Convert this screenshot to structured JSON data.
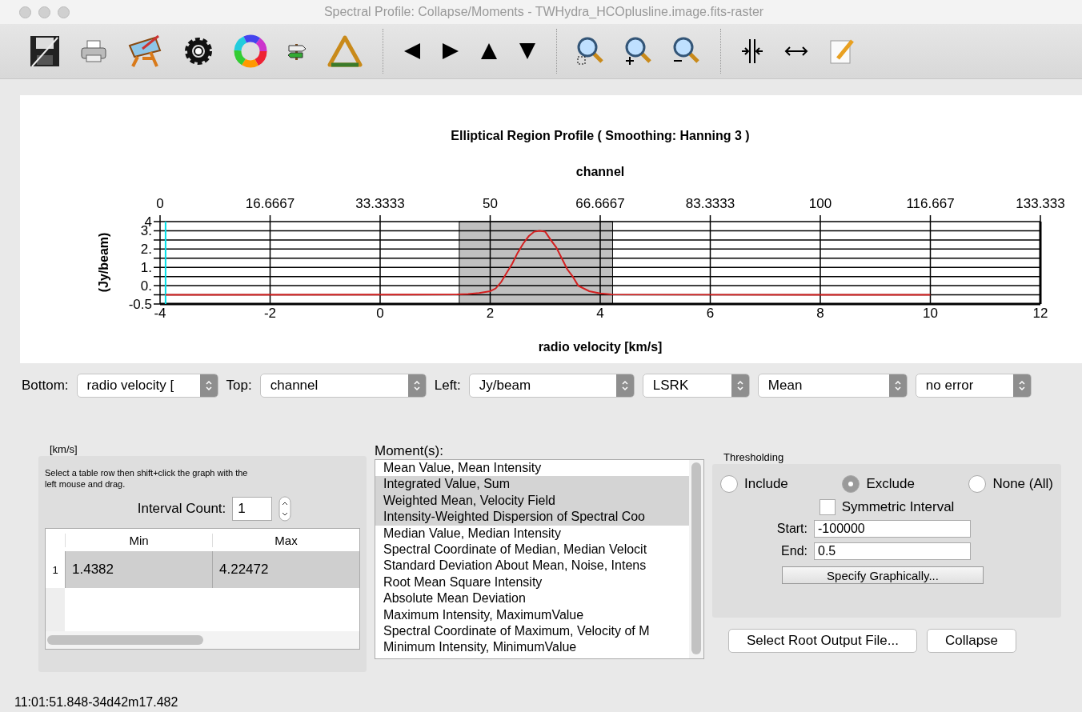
{
  "window": {
    "title": "Spectral Profile: Collapse/Moments - TWHydra_HCOplusline.image.fits-raster"
  },
  "plot": {
    "top_axis": {
      "label": "channel",
      "ticks": [
        "0",
        "16.6667",
        "33.3333",
        "50",
        "66.6667",
        "83.3333",
        "100",
        "116.667",
        "133.333"
      ]
    },
    "chart_data": {
      "type": "line",
      "title": "Elliptical Region Profile ( Smoothing: Hanning 3 )",
      "xlabel": "radio velocity [km/s]",
      "ylabel": "(Jy/beam)",
      "xlim": [
        -4,
        12
      ],
      "ylim": [
        -0.5,
        4
      ],
      "xticks": [
        -4,
        -2,
        0,
        2,
        4,
        6,
        8,
        10,
        12
      ],
      "yticks": [
        {
          "value": 4,
          "label": "4"
        },
        {
          "value": 3.5,
          "label": "3."
        },
        {
          "value": 2.5,
          "label": "2."
        },
        {
          "value": 1.5,
          "label": "1."
        },
        {
          "value": 0.5,
          "label": "0."
        },
        {
          "value": -0.5,
          "label": "-0.5"
        }
      ],
      "x": [
        -3.9,
        1.4,
        1.6,
        1.8,
        2.0,
        2.1,
        2.2,
        2.3,
        2.4,
        2.5,
        2.6,
        2.7,
        2.8,
        2.9,
        3.0,
        3.1,
        3.2,
        3.3,
        3.4,
        3.5,
        3.6,
        3.8,
        4.0,
        4.2,
        10
      ],
      "series": [
        {
          "color": "#d42020",
          "values": [
            0,
            0.02,
            0.05,
            0.1,
            0.2,
            0.35,
            0.7,
            1.2,
            1.7,
            2.3,
            2.8,
            3.2,
            3.45,
            3.5,
            3.45,
            3.0,
            2.6,
            2.0,
            1.4,
            1.0,
            0.5,
            0.2,
            0.08,
            0.02,
            0
          ]
        }
      ],
      "grid": true,
      "ref_lines": [
        {
          "axis": "x",
          "value": -3.9
        }
      ]
    }
  },
  "axis_controls": [
    {
      "label": "Bottom:",
      "value": "radio velocity ["
    },
    {
      "label": "Top:",
      "value": "channel"
    },
    {
      "label": "Left:",
      "value": "Jy/beam"
    },
    {
      "value": "LSRK"
    },
    {
      "value": "Mean"
    },
    {
      "value": "no error"
    }
  ],
  "interval_box": {
    "title": "[km/s]",
    "hint": "Select a table row then shift+click the graph with the left mouse and drag.",
    "count_label": "Interval Count:",
    "count_value": "1",
    "columns": [
      "Min",
      "Max"
    ],
    "rows": [
      {
        "number": "1",
        "cells": [
          "1.4382",
          "4.22472"
        ],
        "selected": true
      }
    ]
  },
  "moments": {
    "label": "Moment(s):",
    "items": [
      {
        "text": "Mean Value, Mean Intensity",
        "selected": false
      },
      {
        "text": "Integrated Value, Sum",
        "selected": true
      },
      {
        "text": "Weighted Mean, Velocity Field",
        "selected": true
      },
      {
        "text": "Intensity-Weighted Dispersion of Spectral Coo",
        "selected": true
      },
      {
        "text": "Median Value, Median Intensity",
        "selected": false
      },
      {
        "text": "Spectral Coordinate of Median, Median Velocit",
        "selected": false
      },
      {
        "text": "Standard Deviation About Mean, Noise, Intens",
        "selected": false
      },
      {
        "text": "Root Mean Square Intensity",
        "selected": false
      },
      {
        "text": "Absolute Mean Deviation",
        "selected": false
      },
      {
        "text": "Maximum Intensity, MaximumValue",
        "selected": false
      },
      {
        "text": "Spectral Coordinate of Maximum, Velocity of M",
        "selected": false
      },
      {
        "text": "Minimum Intensity, MinimumValue",
        "selected": false
      }
    ]
  },
  "thresholding": {
    "title": "Thresholding",
    "options": [
      {
        "label": "Include",
        "selected": false
      },
      {
        "label": "Exclude",
        "selected": true
      },
      {
        "label": "None (All)",
        "selected": false
      }
    ],
    "symmetric": {
      "label": "Symmetric Interval",
      "checked": false
    },
    "start_label": "Start:",
    "start_value": "-100000",
    "end_label": "End:",
    "end_value": "0.5",
    "graph_button": "Specify Graphically..."
  },
  "buttons": [
    "Select Root Output File...",
    "Collapse"
  ],
  "status_bar": "11:01:51.848-34d42m17.482"
}
